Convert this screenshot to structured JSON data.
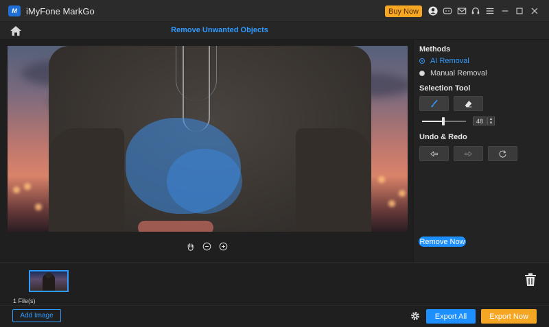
{
  "app": {
    "title": "iMyFone MarkGo",
    "logo_text": "M"
  },
  "titlebar": {
    "buy_label": "Buy Now",
    "icons": [
      "user-icon",
      "discord-icon",
      "mail-icon",
      "headset-icon",
      "menu-icon",
      "minimize-icon",
      "maximize-icon",
      "close-icon"
    ]
  },
  "header": {
    "page_title": "Remove Unwanted Objects"
  },
  "panel": {
    "methods_title": "Methods",
    "methods": [
      {
        "label": "AI Removal",
        "selected": true
      },
      {
        "label": "Manual Removal",
        "selected": false
      }
    ],
    "selection_title": "Selection Tool",
    "brush_size": "48",
    "brush_size_fraction": 0.48,
    "undo_title": "Undo & Redo",
    "remove_now_label": "Remove Now"
  },
  "files": {
    "count_label": "1 File(s)"
  },
  "footer": {
    "add_image_label": "Add Image",
    "export_all_label": "Export All",
    "export_now_label": "Export Now"
  },
  "colors": {
    "accent": "#1e8fff",
    "orange": "#f5a623",
    "title": "#2f9bff"
  }
}
